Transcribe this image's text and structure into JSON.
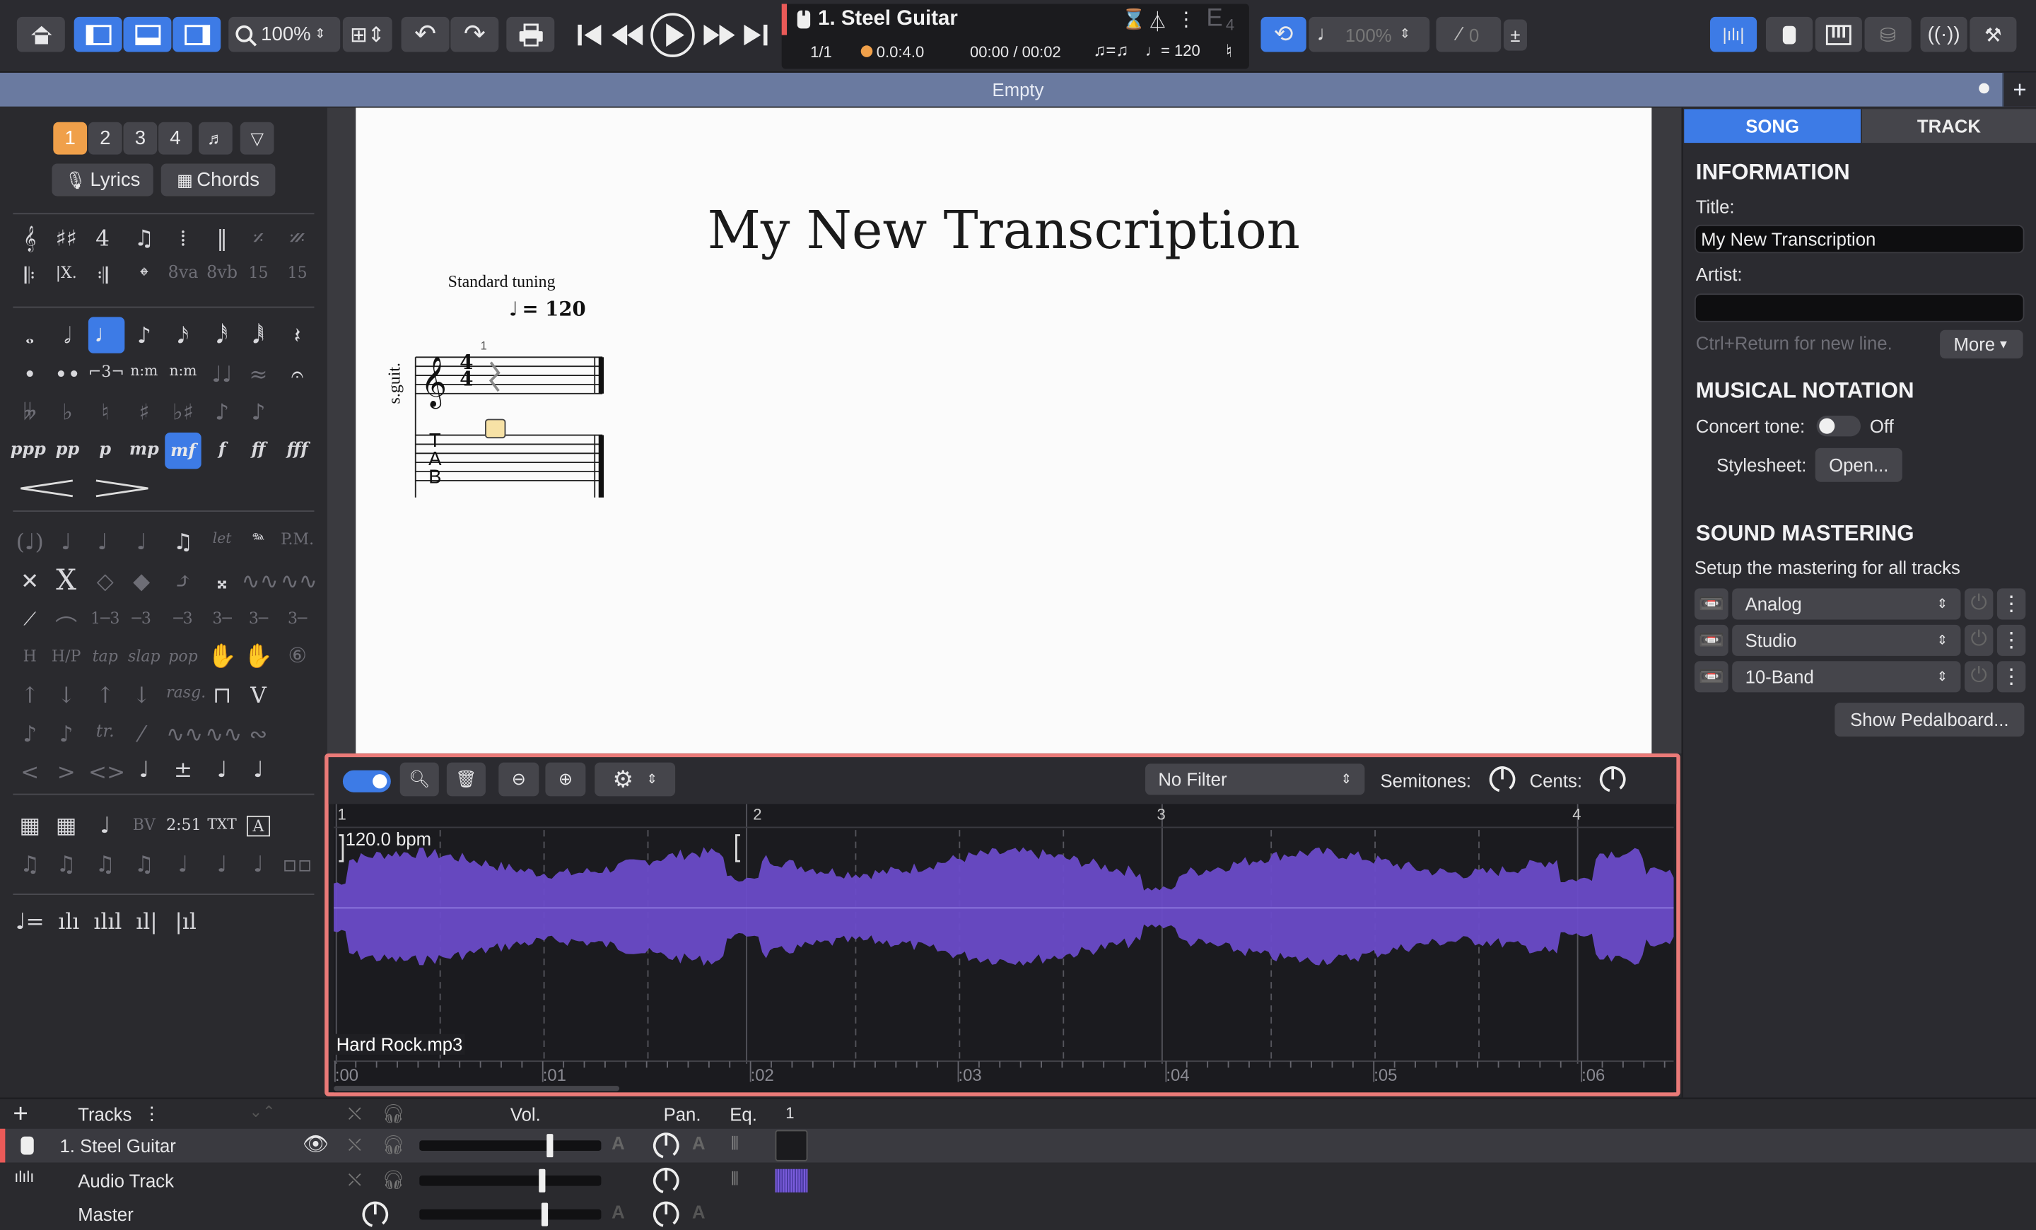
{
  "toolbar": {
    "zoom": "100%",
    "track_name": "1. Steel Guitar",
    "bar_pos": "1/1",
    "beat_pos": "0.0:4.0",
    "time": "00:00 / 00:02",
    "tempo": "♩= 120",
    "swing": "♫=♫",
    "tuning": "E",
    "tuning_sub": "4",
    "speed": "100%",
    "count": "0"
  },
  "tab": {
    "title": "Empty"
  },
  "palette": {
    "voices": [
      "1",
      "2",
      "3",
      "4"
    ],
    "lyrics": "Lyrics",
    "chords": "Chords",
    "dynamics": [
      "ppp",
      "pp",
      "p",
      "mp",
      "mf",
      "f",
      "ff",
      "fff"
    ]
  },
  "score": {
    "title": "My New Transcription",
    "tuning": "Standard tuning",
    "tempo": "= 120",
    "instrument": "s.guit.",
    "bar_number": "1",
    "timesig_top": "4",
    "timesig_bottom": "4",
    "tab_letters": [
      "T",
      "A",
      "B"
    ]
  },
  "right": {
    "tab_song": "SONG",
    "tab_track": "TRACK",
    "information": "INFORMATION",
    "title_label": "Title:",
    "title_value": "My New Transcription",
    "artist_label": "Artist:",
    "artist_value": "",
    "hint": "Ctrl+Return for new line.",
    "more": "More",
    "musical_notation": "MUSICAL NOTATION",
    "concert_tone": "Concert tone:",
    "concert_value": "Off",
    "stylesheet": "Stylesheet:",
    "open": "Open...",
    "sound_mastering": "SOUND MASTERING",
    "mastering_desc": "Setup the mastering for all tracks",
    "mastering": [
      "Analog",
      "Studio",
      "10-Band"
    ],
    "pedalboard": "Show Pedalboard..."
  },
  "audio": {
    "filter": "No Filter",
    "semitones": "Semitones:",
    "cents": "Cents:",
    "bpm": "120.0 bpm",
    "file": "Hard Rock.mp3",
    "bars": [
      "1",
      "2",
      "3",
      "4"
    ],
    "times": [
      ":00",
      ":01",
      ":02",
      ":03",
      ":04",
      ":05",
      ":06"
    ]
  },
  "tracks": {
    "header": "Tracks",
    "vol": "Vol.",
    "pan": "Pan.",
    "eq": "Eq.",
    "bar": "1",
    "rows": [
      {
        "name": "1. Steel Guitar",
        "vol": 0.82
      },
      {
        "name": "Audio Track",
        "vol": 0.77
      },
      {
        "name": "Master",
        "vol": 0.78
      }
    ]
  },
  "colors": {
    "accent": "#3d7be6",
    "waveform": "#6a4bc8",
    "highlight": "#ea7a78",
    "voice_active": "#f0a04a"
  }
}
